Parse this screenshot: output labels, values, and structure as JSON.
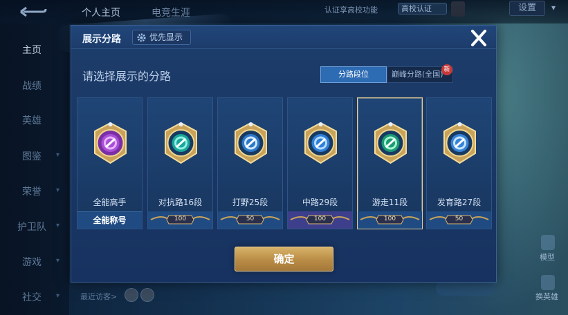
{
  "topbar": {
    "tabs": [
      "个人主页",
      "电竞生涯"
    ],
    "auth_link": "认证享高校功能",
    "school_badge": "高校认证",
    "settings": "设置"
  },
  "sidebar": {
    "items": [
      "主页",
      "战绩",
      "英雄",
      "图鉴",
      "荣誉",
      "护卫队",
      "游戏",
      "社交"
    ]
  },
  "recent": {
    "label": "最近访客>"
  },
  "right_side": {
    "skin_label": "模型",
    "switch_label": "换英雄"
  },
  "modal": {
    "title": "展示分路",
    "priority_button": "优先显示",
    "prompt": "请选择展示的分路",
    "segments": {
      "rank": "分路段位",
      "peak": "巅峰分路(全国)",
      "new_badge": "新"
    },
    "cards": [
      {
        "label": "全能高手",
        "footer": "全能称号",
        "emblem": "purple-square",
        "rank_badge": ""
      },
      {
        "label": "对抗路16段",
        "footer": "",
        "emblem": "teal-swords",
        "rank_badge": "100"
      },
      {
        "label": "打野25段",
        "footer": "",
        "emblem": "blue-claw",
        "rank_badge": "50"
      },
      {
        "label": "中路29段",
        "footer": "",
        "emblem": "blue-slash",
        "rank_badge": "100"
      },
      {
        "label": "游走11段",
        "footer": "",
        "emblem": "green-leaf",
        "rank_badge": "100"
      },
      {
        "label": "发育路27段",
        "footer": "",
        "emblem": "blue-target",
        "rank_badge": "50"
      }
    ],
    "selected_index": 4,
    "confirm": "确定"
  },
  "colors": {
    "accent": "#2d6bb3",
    "gold": "#d7b26a",
    "modal_bg": "#1b3a66"
  }
}
